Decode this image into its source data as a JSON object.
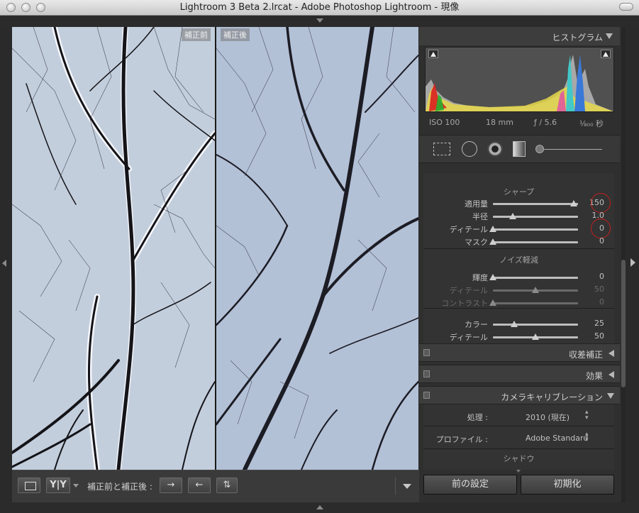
{
  "window": {
    "title": "Lightroom 3 Beta 2.lrcat - Adobe Photoshop Lightroom - 現像"
  },
  "compare": {
    "before_label": "補正前",
    "after_label": "補正後"
  },
  "toolbar": {
    "yy_label": "Y|Y",
    "before_after_label": "補正前と補正後 :",
    "swap_icons": [
      "→",
      "←",
      "⇅"
    ]
  },
  "histogram": {
    "title": "ヒストグラム",
    "iso": "ISO 100",
    "focal": "18 mm",
    "aperture": "ƒ / 5.6",
    "shutter": "¹⁄₈₀₀ 秒"
  },
  "detail": {
    "sharpen_title": "シャープ",
    "sharpen": [
      {
        "label": "適用量",
        "value": "150",
        "pos": 0.95,
        "dim": false,
        "circled": true
      },
      {
        "label": "半径",
        "value": "1.0",
        "pos": 0.23,
        "dim": false,
        "circled": false
      },
      {
        "label": "ディテール",
        "value": "0",
        "pos": 0.0,
        "dim": false,
        "circled": true
      },
      {
        "label": "マスク",
        "value": "0",
        "pos": 0.0,
        "dim": false,
        "circled": false
      }
    ],
    "noise_title": "ノイズ軽減",
    "noise": [
      {
        "label": "輝度",
        "value": "0",
        "pos": 0.0,
        "dim": false
      },
      {
        "label": "ディテール",
        "value": "50",
        "pos": 0.5,
        "dim": true
      },
      {
        "label": "コントラスト",
        "value": "0",
        "pos": 0.0,
        "dim": true
      },
      {
        "label": "カラー",
        "value": "25",
        "pos": 0.25,
        "dim": false
      },
      {
        "label": "ディテール",
        "value": "50",
        "pos": 0.5,
        "dim": false
      }
    ]
  },
  "panels": {
    "lens_correction": "収差補正",
    "effects": "効果",
    "camera_calibration": "カメラキャリブレーション"
  },
  "calibration": {
    "process_label": "処理 :",
    "process_value": "2010 (現在)",
    "profile_label": "プロファイル :",
    "profile_value": "Adobe Standard",
    "shadow_label": "シャドウ"
  },
  "buttons": {
    "previous": "前の設定",
    "reset": "初期化"
  },
  "colors": {
    "accent_red": "#c41e1e",
    "panel_bg": "#2f2f2f"
  }
}
